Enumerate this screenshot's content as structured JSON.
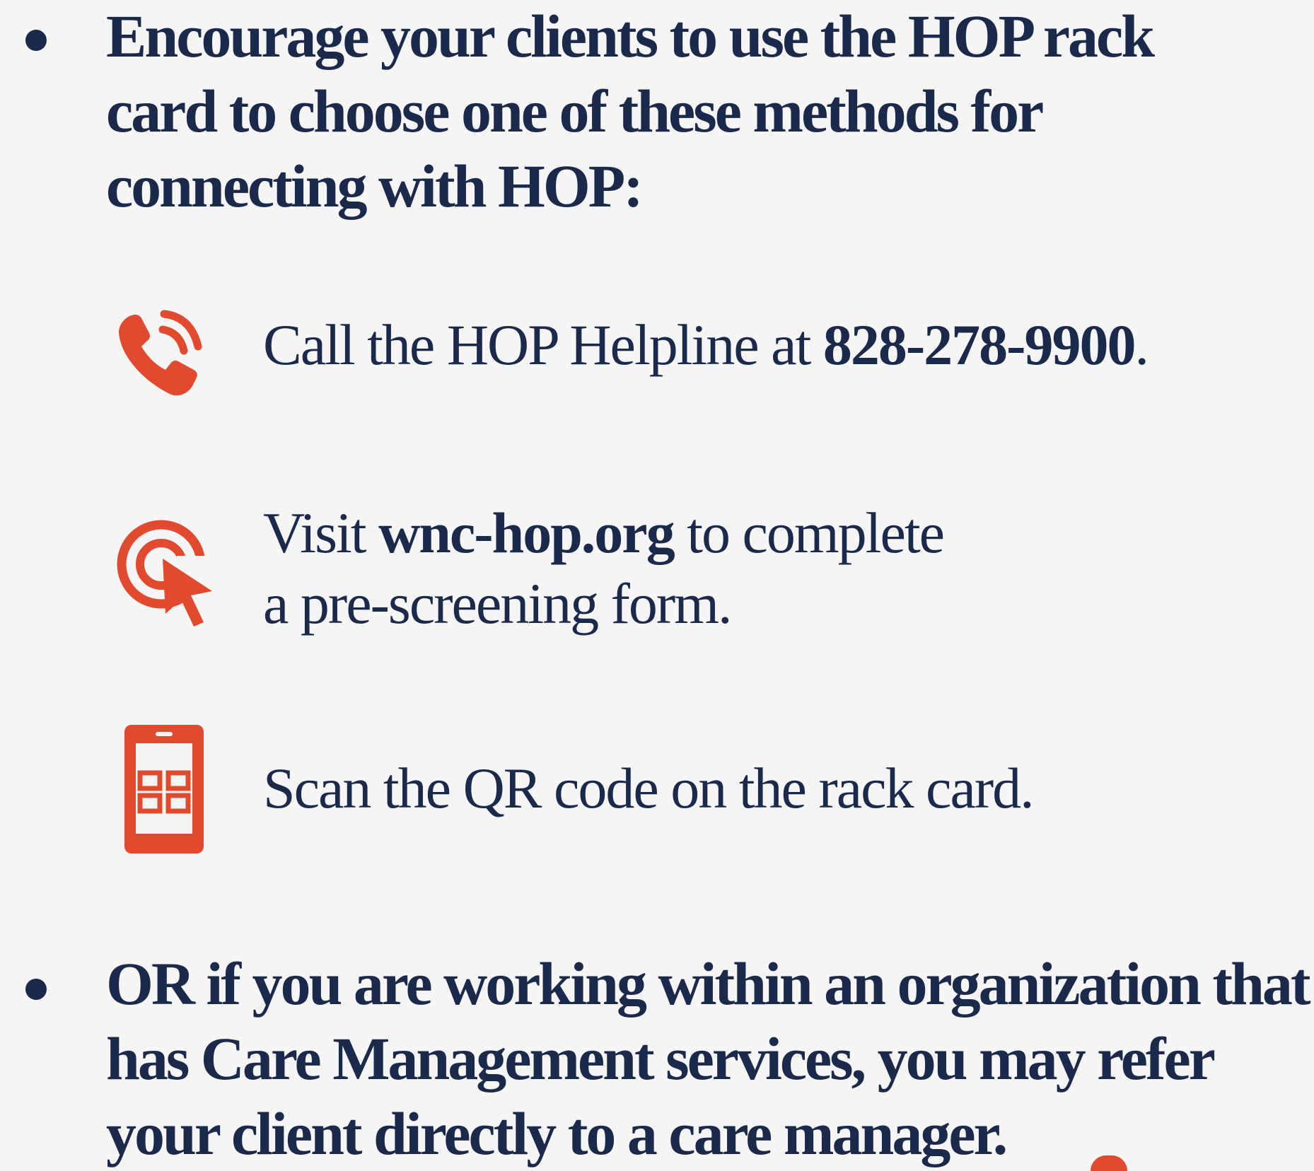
{
  "bullets": [
    {
      "lines": [
        "Encourage your clients to use the HOP rack",
        "card to choose one of these methods for",
        "connecting with HOP:"
      ]
    },
    {
      "lines": [
        "OR if you are working within an organization that",
        "has Care Management services, you may refer",
        "your client directly to a care manager."
      ]
    }
  ],
  "methods": [
    {
      "icon": "phone-icon",
      "prefix": "Call the HOP Helpline at ",
      "emphasis": "828-278-9900",
      "suffix": "."
    },
    {
      "icon": "click-target-icon",
      "prefix": "Visit ",
      "emphasis": "wnc-hop.org",
      "suffix": " to complete",
      "line2": "a pre-screening form."
    },
    {
      "icon": "tablet-qr-icon",
      "text": "Scan the QR code on the rack card."
    }
  ],
  "colors": {
    "navy": "#1b2a4a",
    "accent_red": "#e14a2e",
    "background": "#f5f5f5"
  }
}
